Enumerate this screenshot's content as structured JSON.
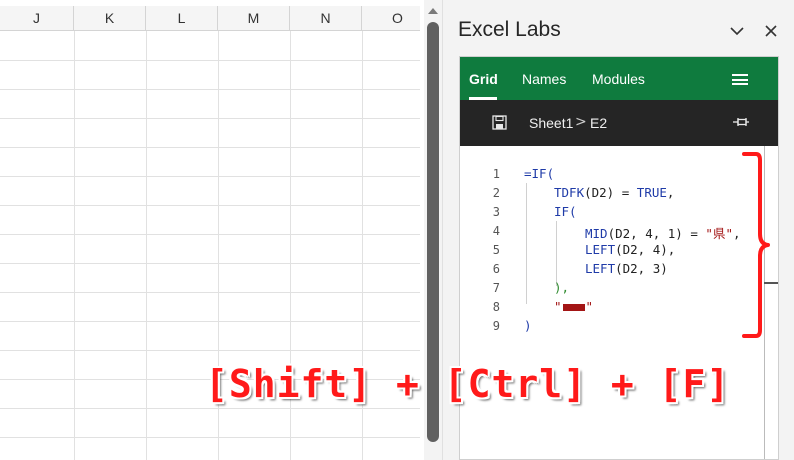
{
  "sheet": {
    "columns": [
      "J",
      "K",
      "L",
      "M",
      "N",
      "O"
    ]
  },
  "pane": {
    "title": "Excel Labs",
    "tabs": [
      {
        "label": "Grid",
        "active": true
      },
      {
        "label": "Names",
        "active": false
      },
      {
        "label": "Modules",
        "active": false
      }
    ],
    "breadcrumb": {
      "sheet": "Sheet1",
      "separator": ">",
      "cell": "E2"
    },
    "icons": {
      "collapse": "chevron-down-icon",
      "close": "close-icon",
      "menu": "hamburger-menu-icon",
      "save": "save-icon",
      "pin": "pin-icon"
    },
    "colors": {
      "tab_bar": "#0f7b3e",
      "breadcrumb_bar": "#252525",
      "keyword": "#1f3ba8",
      "string": "#a31515"
    }
  },
  "editor": {
    "line_numbers": [
      "1",
      "2",
      "3",
      "4",
      "5",
      "6",
      "7",
      "8",
      "9"
    ],
    "lines": {
      "l1": {
        "p0": "=IF("
      },
      "l2": {
        "fn": "TDFK",
        "p1": "(D2) = ",
        "bool": "TRUE",
        "p2": ","
      },
      "l3": {
        "fn": "IF("
      },
      "l4": {
        "fn": "MID",
        "p1": "(D2, 4, 1) = ",
        "str": "\"県\"",
        "p2": ","
      },
      "l5": {
        "fn": "LEFT",
        "p1": "(D2, 4),"
      },
      "l6": {
        "fn": "LEFT",
        "p1": "(D2, 3)"
      },
      "l7": {
        "p1": "),"
      },
      "l8": {
        "q1": "\"",
        "q2": "\""
      },
      "l9": {
        "p0": ")"
      }
    }
  },
  "annotation": {
    "shortcut": "[Shift] + [Ctrl] + [F]",
    "color": "#ff1a1a"
  }
}
